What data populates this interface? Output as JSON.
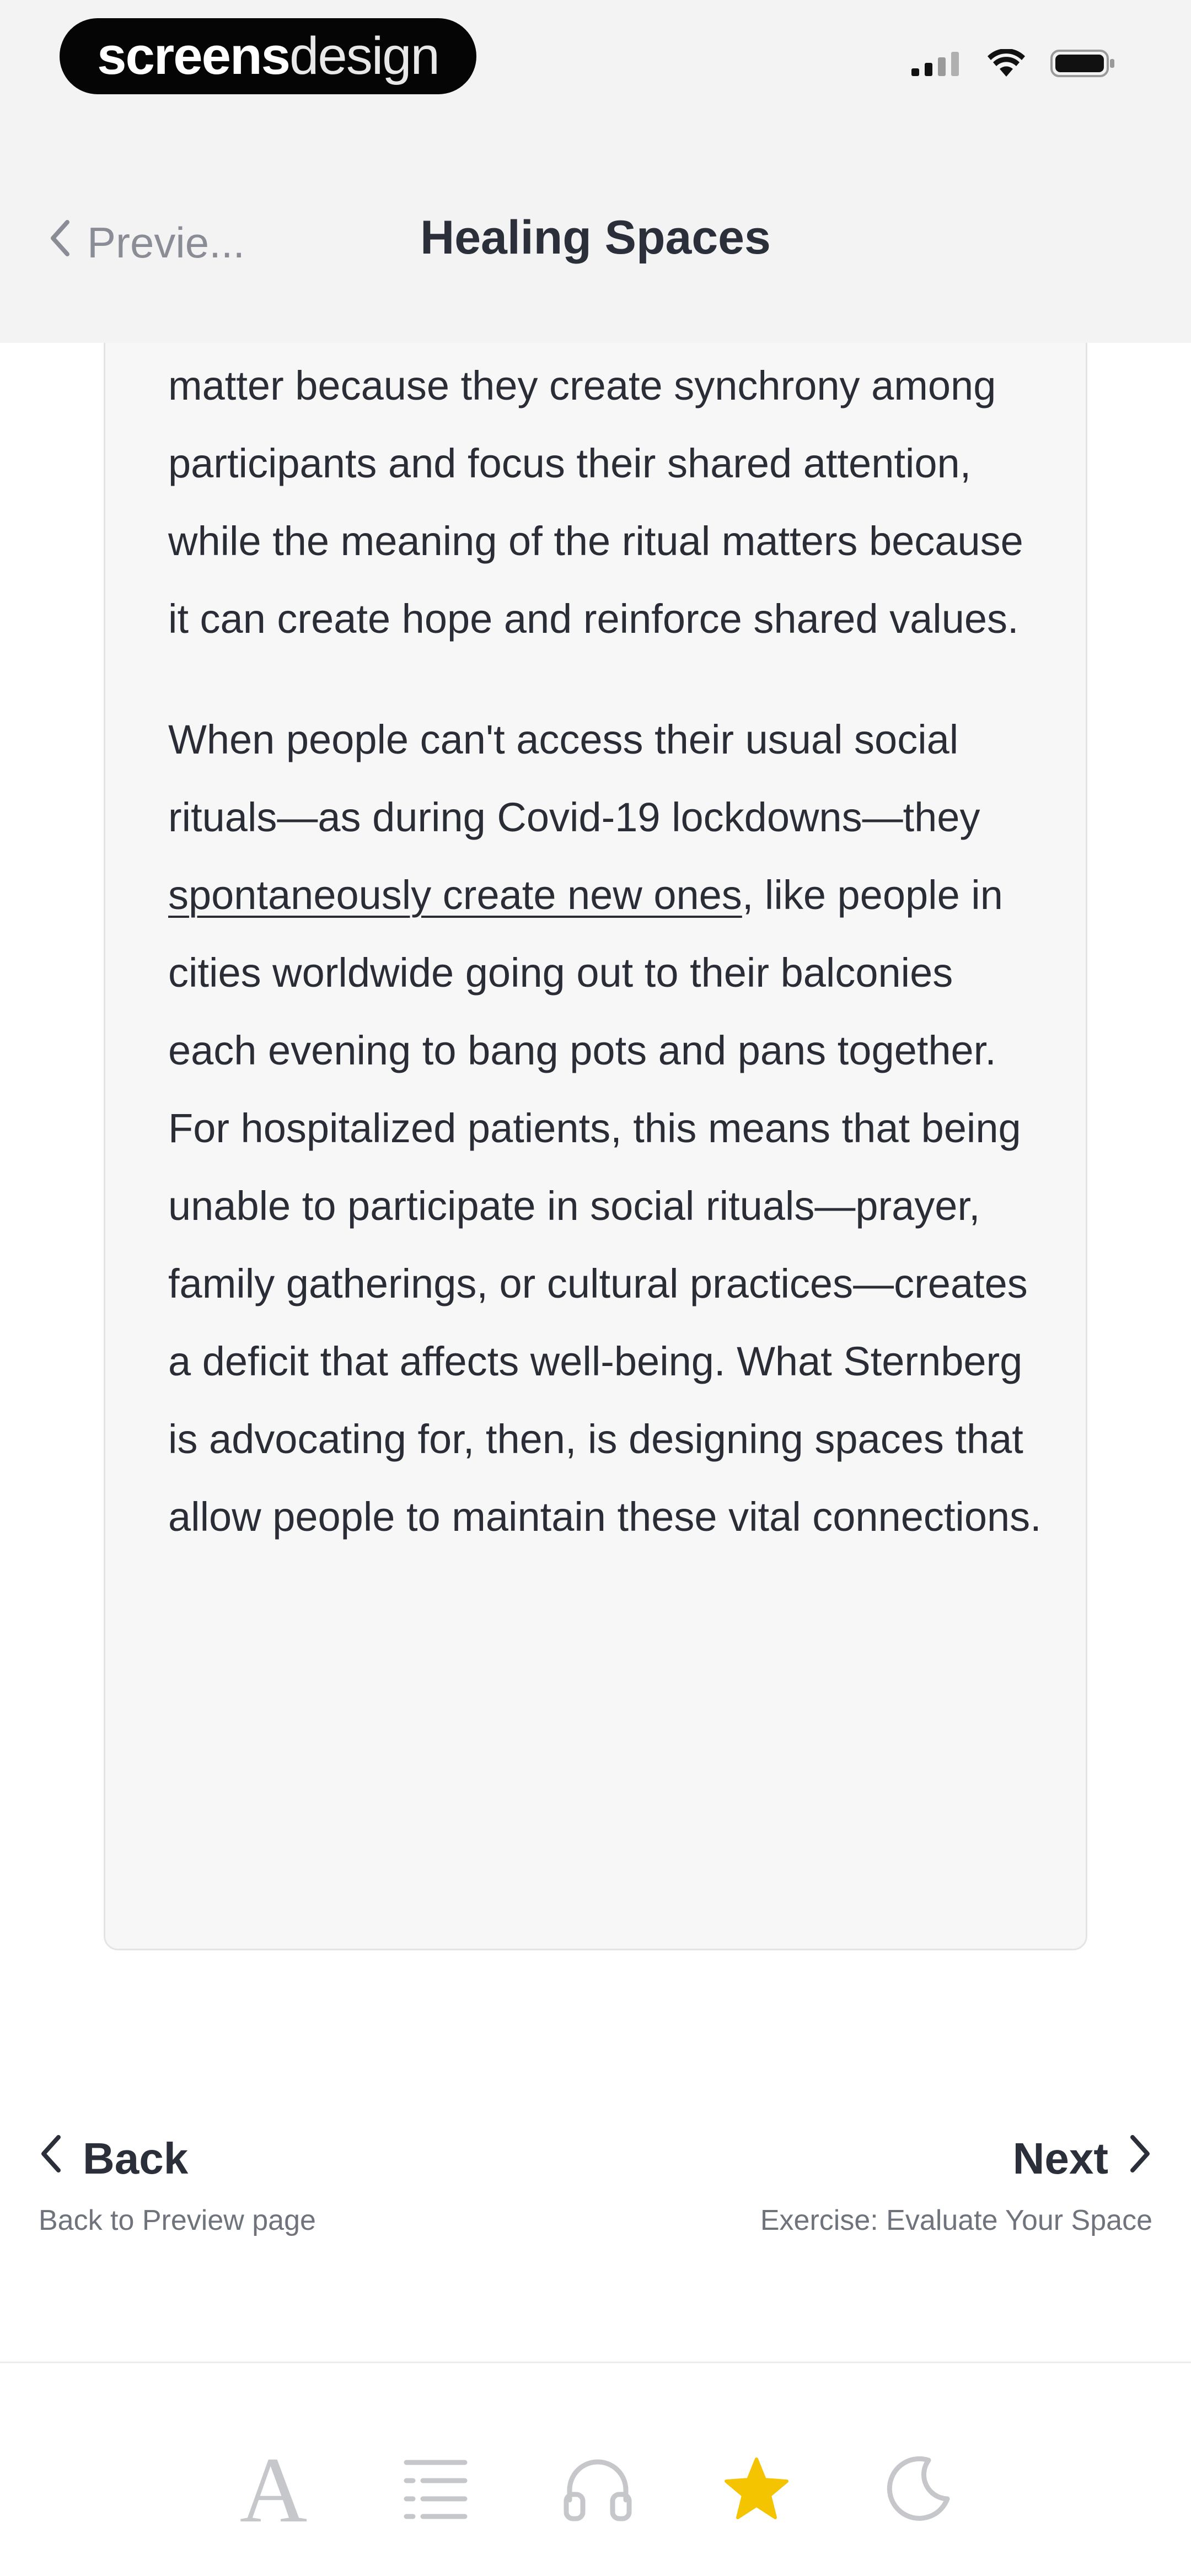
{
  "watermark": {
    "bold": "screens",
    "light": "design"
  },
  "status_bar": {
    "signal_icon": "cellular-signal-icon",
    "wifi_icon": "wifi-icon",
    "battery_icon": "battery-icon"
  },
  "nav": {
    "back_label": "Previe...",
    "title": "Healing Spaces"
  },
  "content": {
    "paragraph_1": "experiences. The actions involved in a ritual matter because they create synchrony among participants and focus their shared attention, while the meaning of the ritual matters because it can create hope and reinforce shared values.",
    "paragraph_2_before_link": "When people can't access their usual social rituals—as during Covid-19 lockdowns—they ",
    "paragraph_2_link": "spontaneously create new ones",
    "paragraph_2_after_link": ", like people in cities worldwide going out to their balconies each evening to bang pots and pans together. For hospitalized patients, this means that being unable to participate in social rituals—prayer, family gatherings, or cultural practices—creates a deficit that affects well-being. What Sternberg is advocating for, then, is designing spaces that allow people to maintain these vital connections."
  },
  "pager": {
    "back_label": "Back",
    "back_subtitle": "Back to Preview page",
    "next_label": "Next",
    "next_subtitle": "Exercise: Evaluate Your Space"
  },
  "toolbar": {
    "font_glyph": "A",
    "items": [
      "font-size-icon",
      "table-of-contents-icon",
      "headphones-icon",
      "star-icon",
      "moon-icon"
    ],
    "active_color": "#f5c400",
    "inactive_color": "#c6c7cb"
  }
}
